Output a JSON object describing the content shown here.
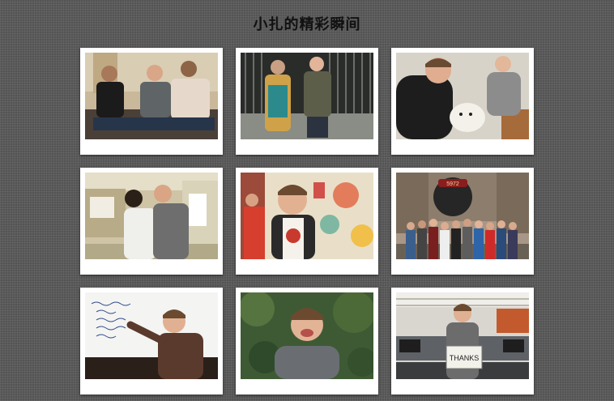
{
  "page": {
    "title": "小扎的精彩瞬间"
  },
  "gallery": {
    "photos": [
      {
        "subject": "three-men-on-sofa"
      },
      {
        "subject": "couple-by-iron-fence"
      },
      {
        "subject": "holding-white-dog"
      },
      {
        "subject": "kiss-at-house"
      },
      {
        "subject": "smiling-by-mural"
      },
      {
        "subject": "group-at-steam-engine"
      },
      {
        "subject": "writing-on-whiteboard"
      },
      {
        "subject": "laughing-outdoors"
      },
      {
        "subject": "thanks-sign-office"
      }
    ],
    "photo_9_sign_text": "THANKS"
  }
}
